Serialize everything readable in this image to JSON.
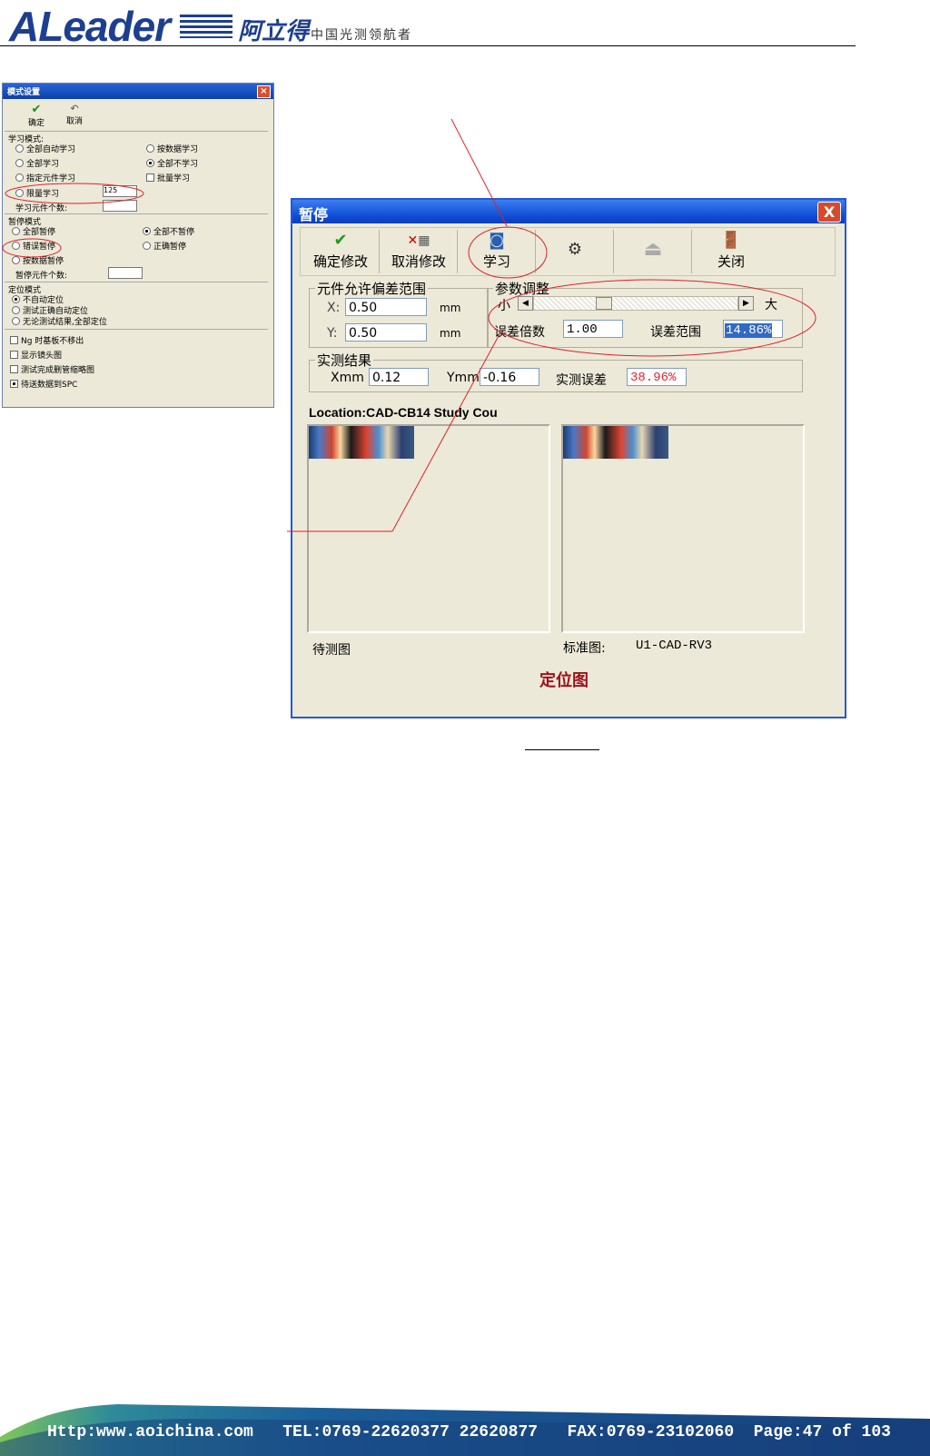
{
  "header": {
    "brand": "ALeader",
    "brand_cn": "阿立得",
    "tagline": "中国光测领航者"
  },
  "mode_dialog": {
    "title": "模式设置",
    "close": "×",
    "toolbar": {
      "ok": "确定",
      "cancel": "取消"
    },
    "learn_group": {
      "label": "学习模式:",
      "options": [
        "全部自动学习",
        "按数据学习",
        "全部学习",
        "全部不学习",
        "指定元件学习",
        "批量学习",
        "限量学习"
      ],
      "limit_value": "125",
      "count_label": "学习元件个数:"
    },
    "pause_group": {
      "label": "暂停模式",
      "options": [
        "全部暂停",
        "全部不暂停",
        "错误暂停",
        "正确暂停",
        "按数据暂停"
      ],
      "count_label": "暂停元件个数:"
    },
    "locate_group": {
      "label": "定位模式",
      "options": [
        "不自动定位",
        "测试正确自动定位",
        "无论测试结果,全部定位"
      ]
    },
    "checks": [
      "Ng 时基板不移出",
      "显示镜头图",
      "测试完成删管缩略图",
      "待送数据到SPC"
    ]
  },
  "main_dialog": {
    "title": "暂停",
    "close": "X",
    "toolbar": {
      "confirm": "确定修改",
      "cancel": "取消修改",
      "learn": "学习",
      "close": "关闭"
    },
    "tolerance": {
      "legend": "元件允许偏差范围",
      "x_label": "X:",
      "x_value": "0.50",
      "x_unit": "mm",
      "y_label": "Y:",
      "y_value": "0.50",
      "y_unit": "mm"
    },
    "params": {
      "legend": "参数调整",
      "small": "小",
      "large": "大",
      "multiplier_label": "误差倍数",
      "multiplier_value": "1.00",
      "range_label": "误差范围",
      "range_value": "14.86%",
      "slider_position": 0.33
    },
    "result": {
      "legend": "实测结果",
      "x_label": "Xmm",
      "x_value": "0.12",
      "y_label": "Ymm",
      "y_value": "-0.16",
      "err_label": "实测误差",
      "err_value": "38.96%"
    },
    "location": "Location:CAD-CB14 Study Cou",
    "left_caption": "待测图",
    "right_caption": "标准图:",
    "right_caption_value": "U1-CAD-RV3",
    "bottom_title": "定位图"
  },
  "footer": {
    "text": "Http:www.aoichina.com   TEL:0769-22620377 22620877   FAX:0769-23102060  Page:47 of 103"
  },
  "colors": {
    "accent": "#1e3f8f",
    "annotation": "#e0202a",
    "titlebar": "#0f4cd6",
    "dialog_bg": "#ece9d8",
    "error_text": "#e8202a",
    "bottom_title": "#a0101a"
  }
}
